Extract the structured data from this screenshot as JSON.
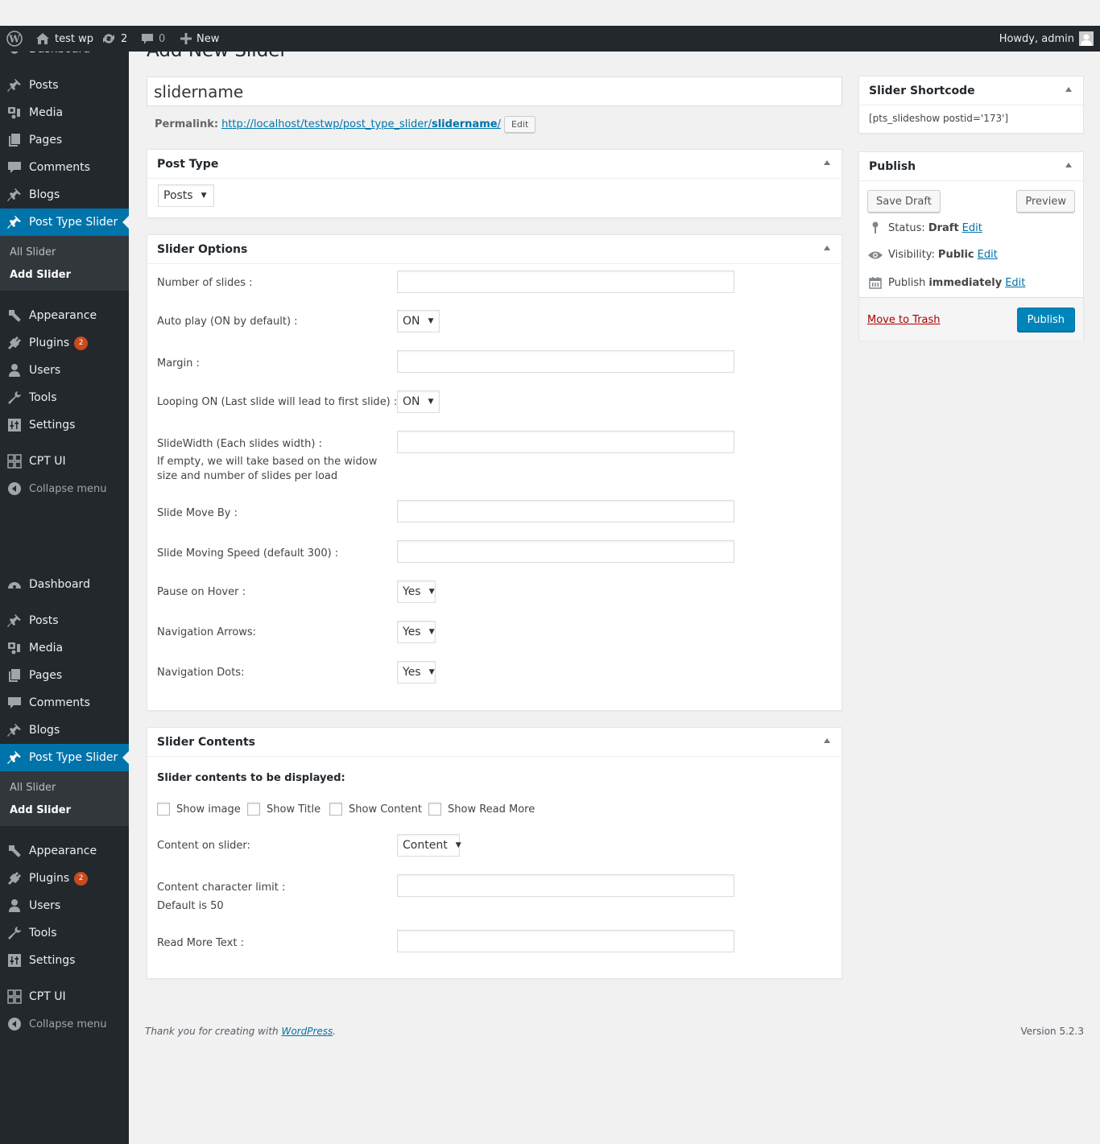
{
  "adminbar": {
    "site_name": "test wp",
    "updates_count": "2",
    "comments_count": "0",
    "new_label": "New",
    "greeting": "Howdy, admin"
  },
  "sidebar": {
    "top_cut_label": "Dashboard",
    "group1": [
      "Posts",
      "Media",
      "Pages",
      "Comments",
      "Blogs"
    ],
    "current": "Post Type Slider",
    "submenu": [
      "All Slider",
      "Add Slider"
    ],
    "group2": [
      "Appearance",
      "Plugins",
      "Users",
      "Tools",
      "Settings"
    ],
    "plugins_badge": "2",
    "cpt": "CPT UI",
    "collapse": "Collapse menu",
    "dashboard": "Dashboard"
  },
  "page": {
    "title": "Add New Slider",
    "post_title": "slidername",
    "permalink_label": "Permalink:",
    "permalink_base": "http://localhost/testwp/post_type_slider/",
    "permalink_slug": "slidername",
    "permalink_trail": "/",
    "edit_label": "Edit"
  },
  "post_type_box": {
    "title": "Post Type",
    "selected": "Posts"
  },
  "slider_options": {
    "title": "Slider Options",
    "fields": {
      "number_of_slides": {
        "label": "Number of slides :",
        "value": ""
      },
      "auto_play": {
        "label": "Auto play (ON by default) :",
        "selected": "ON"
      },
      "margin": {
        "label": "Margin :",
        "value": ""
      },
      "looping": {
        "label": "Looping ON (Last slide will lead to first slide) :",
        "selected": "ON"
      },
      "slide_width": {
        "label": "SlideWidth (Each slides width) :",
        "hint": "If empty, we will take based on the widow size and number of slides per load",
        "value": ""
      },
      "slide_move_by": {
        "label": "Slide Move By :",
        "value": ""
      },
      "slide_speed": {
        "label": "Slide Moving Speed (default 300) :",
        "value": ""
      },
      "pause_on_hover": {
        "label": "Pause on Hover :",
        "selected": "Yes"
      },
      "nav_arrows": {
        "label": "Navigation Arrows:",
        "selected": "Yes"
      },
      "nav_dots": {
        "label": "Navigation Dots:",
        "selected": "Yes"
      }
    }
  },
  "slider_contents": {
    "title": "Slider Contents",
    "subtitle": "Slider contents to be displayed:",
    "checkboxes": [
      {
        "label": "Show image",
        "checked": false
      },
      {
        "label": "Show Title",
        "checked": false
      },
      {
        "label": "Show Content",
        "checked": false
      },
      {
        "label": "Show Read More",
        "checked": false
      }
    ],
    "content_on_slider": {
      "label": "Content on slider:",
      "selected": "Content"
    },
    "char_limit": {
      "label": "Content character limit :",
      "hint": "Default is 50",
      "value": ""
    },
    "read_more_text": {
      "label": "Read More Text :",
      "value": ""
    }
  },
  "shortcode_box": {
    "title": "Slider Shortcode",
    "code": "[pts_slideshow postid='173']"
  },
  "publish_box": {
    "title": "Publish",
    "save_draft": "Save Draft",
    "preview": "Preview",
    "status_label": "Status:",
    "status_value": "Draft",
    "visibility_label": "Visibility:",
    "visibility_value": "Public",
    "publish_label": "Publish",
    "publish_value": "immediately",
    "edit": "Edit",
    "trash": "Move to Trash",
    "publish_button": "Publish"
  },
  "footer": {
    "thanks": "Thank you for creating with ",
    "wp_link": "WordPress",
    "period": ".",
    "version": "Version 5.2.3"
  },
  "colors": {
    "accent": "#0073aa",
    "sidebar_bg": "#23282d",
    "publish_btn": "#0085ba",
    "badge": "#ca4a1f",
    "trash": "#a00"
  }
}
